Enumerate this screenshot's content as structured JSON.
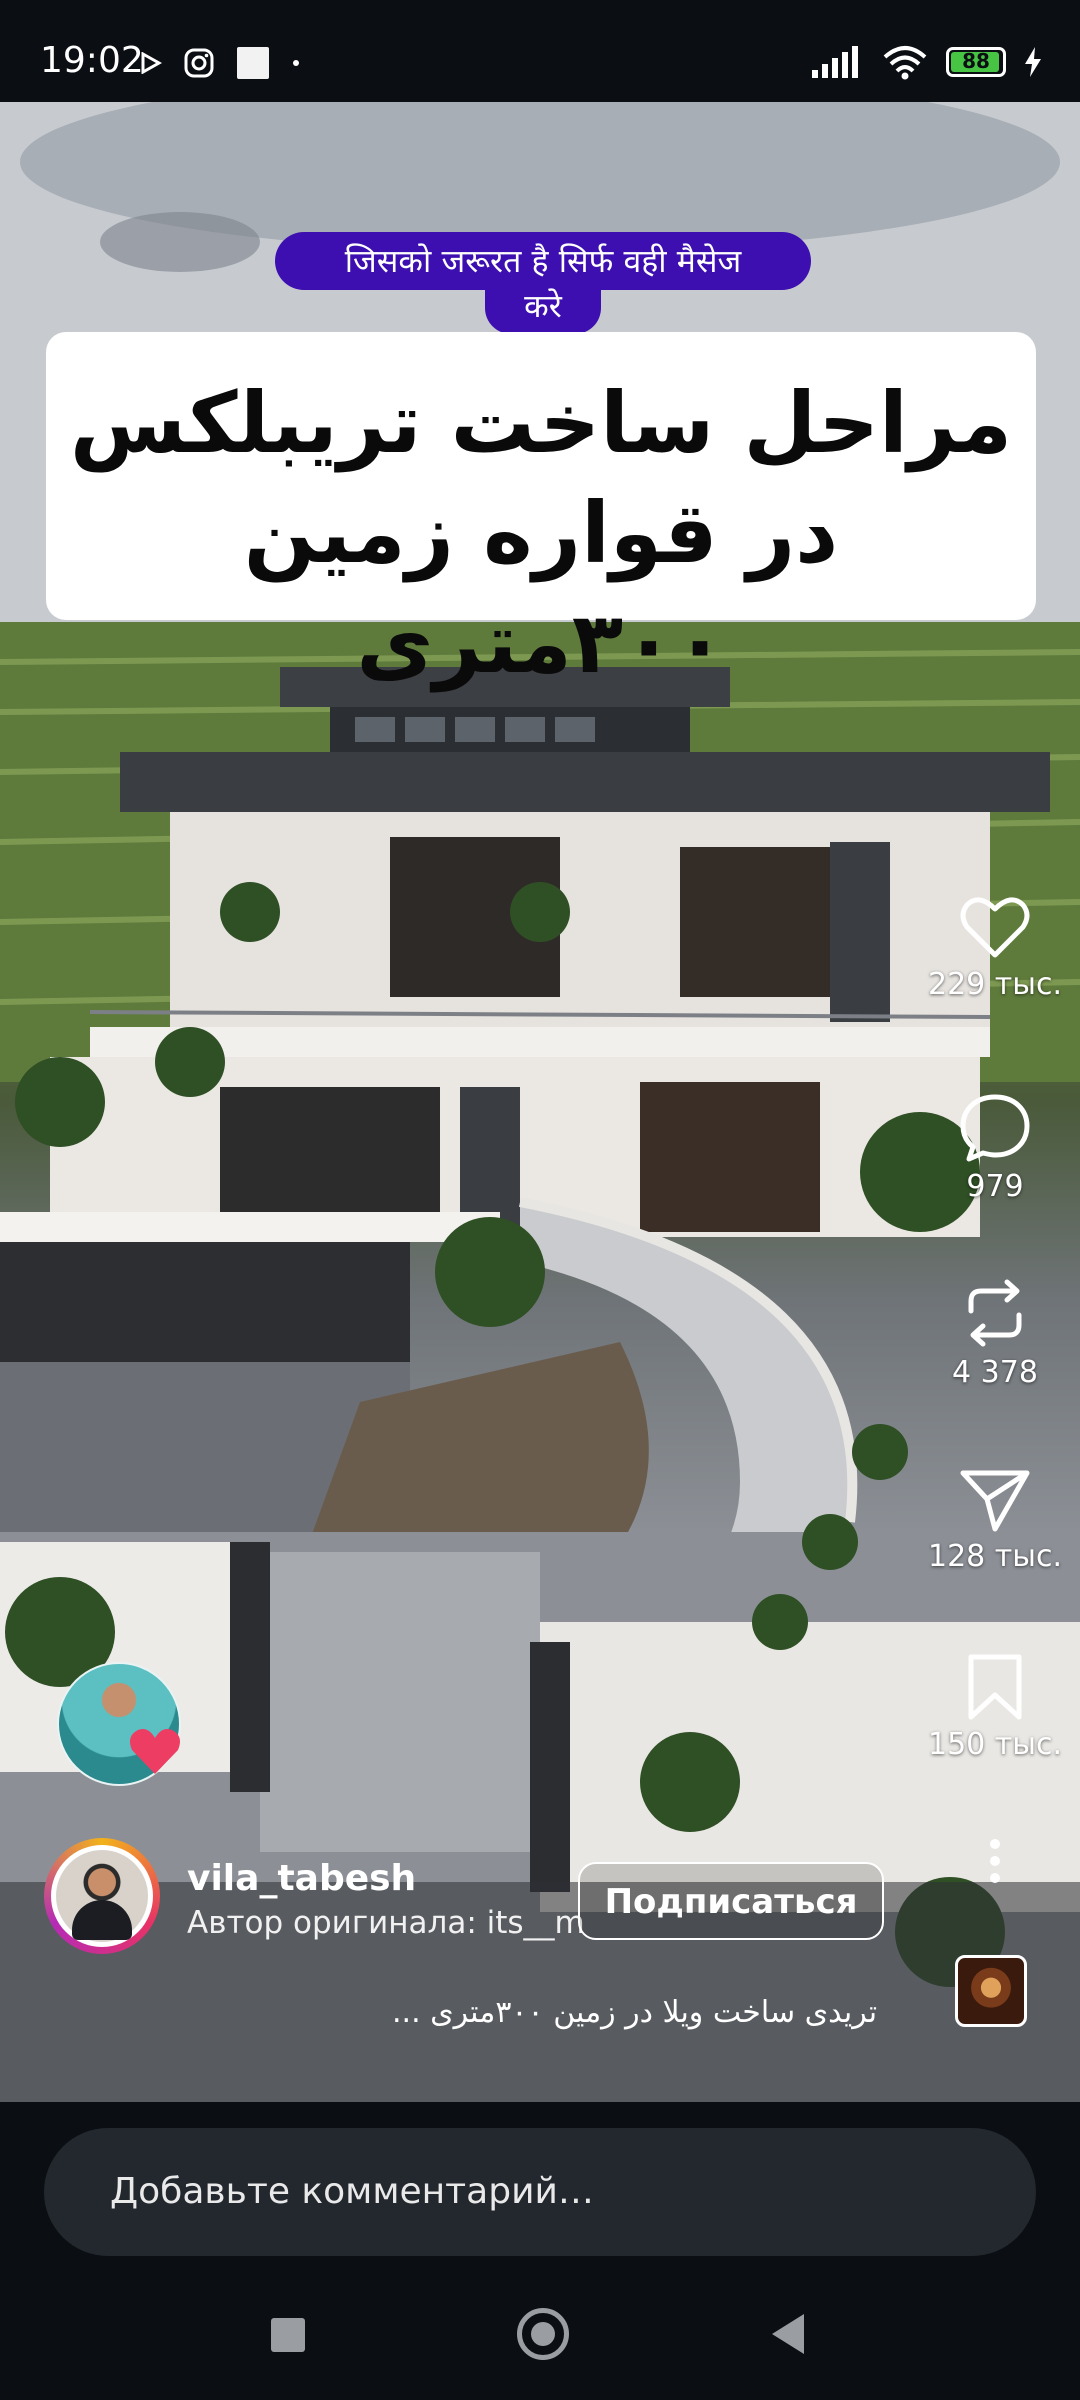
{
  "status_bar": {
    "time": "19:02",
    "battery_level": "88",
    "icons_left": [
      "play-icon",
      "instagram-icon",
      "app-square-icon",
      "dot-icon"
    ],
    "icons_right": [
      "signal-icon",
      "wifi-icon",
      "battery-icon",
      "charging-icon"
    ]
  },
  "overlay": {
    "hindi_line1": "जिसको जरूरत है सिर्फ वही मैसेज",
    "hindi_line2": "करे",
    "title_line1": "مراحل ساخت تریبلکس",
    "title_line2": "در قواره زمین ۳۰۰متری"
  },
  "actions": {
    "likes": "229 тыс.",
    "comments": "979",
    "reposts": "4 378",
    "shares": "128 тыс.",
    "saves": "150 тыс."
  },
  "author": {
    "username": "vila_tabesh",
    "original_author": "Автор оригинала: its__m",
    "follow_label": "Подписаться"
  },
  "caption": "تریدی ساخت ویلا در زمین ۳۰۰متری ...",
  "comment": {
    "placeholder": "Добавьте комментарий…"
  },
  "colors": {
    "banner": "#3d0fb0",
    "battery": "#47c443",
    "background": "#0b0f14"
  }
}
